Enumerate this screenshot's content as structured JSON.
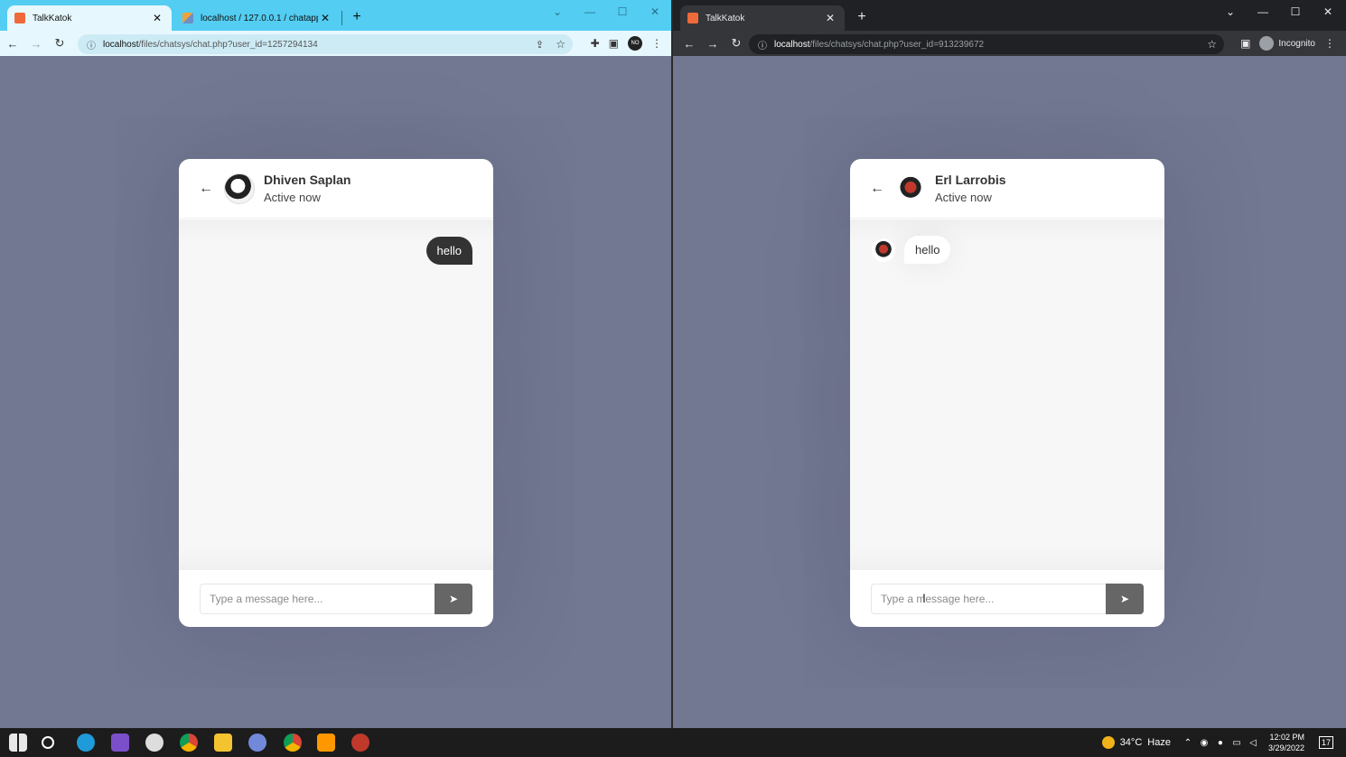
{
  "left_window": {
    "tabs": [
      {
        "title": "TalkKatok",
        "active": true
      },
      {
        "title": "localhost / 127.0.0.1 / chatapp / ...",
        "active": false
      }
    ],
    "url_host": "localhost",
    "url_path": "/files/chatsys/chat.php?user_id=1257294134",
    "profile_badge": "NO",
    "chat": {
      "name": "Dhiven Saplan",
      "status": "Active now",
      "outgoing_message": "hello",
      "input_placeholder": "Type a message here..."
    }
  },
  "right_window": {
    "tabs": [
      {
        "title": "TalkKatok",
        "active": true
      }
    ],
    "url_host": "localhost",
    "url_path": "/files/chatsys/chat.php?user_id=913239672",
    "incognito_label": "Incognito",
    "chat": {
      "name": "Erl Larrobis",
      "status": "Active now",
      "incoming_message": "hello",
      "input_placeholder": "Type a message here..."
    }
  },
  "taskbar": {
    "weather_temp": "34°C",
    "weather_desc": "Haze",
    "time": "12:02 PM",
    "date": "3/29/2022",
    "notification_count": "17"
  },
  "colors": {
    "page_background": "#727792",
    "left_chrome_tabstrip": "#53cdf2",
    "right_chrome_tabstrip": "#202124",
    "bubble_dark": "#333333"
  }
}
